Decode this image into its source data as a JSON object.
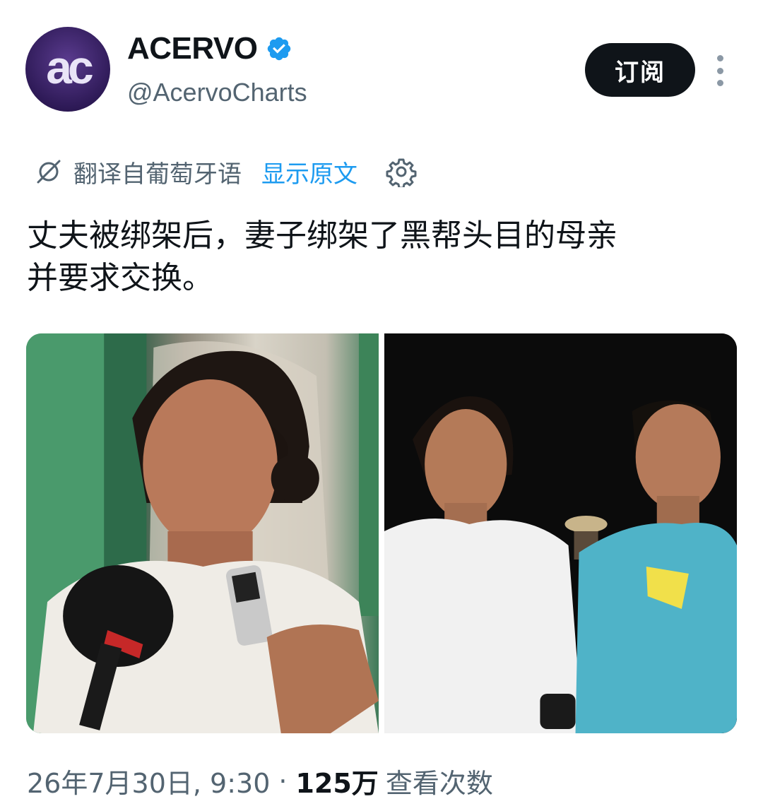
{
  "account": {
    "avatar_text": "ac",
    "display_name": "ACERVO",
    "handle": "@AcervoCharts",
    "verified_icon": "verified-badge-icon"
  },
  "actions": {
    "subscribe_label": "订阅",
    "more_icon": "more-vertical-icon"
  },
  "translation": {
    "icon": "translate-icon",
    "label": "翻译自葡萄牙语",
    "show_original": "显示原文",
    "settings_icon": "gear-icon"
  },
  "tweet": {
    "text": "丈夫被绑架后，妻子绑架了黑帮头目的母亲\n并要求交换。"
  },
  "media": {
    "left_photo": "woman-interview-photo",
    "right_photo": "couple-night-photo"
  },
  "meta": {
    "timestamp": "26年7月30日, 9:30",
    "separator": "·",
    "views_count": "125万",
    "views_label": "查看次数"
  },
  "colors": {
    "accent_blue": "#1d9bf0",
    "text_dark": "#0f1419",
    "text_gray": "#536471"
  }
}
